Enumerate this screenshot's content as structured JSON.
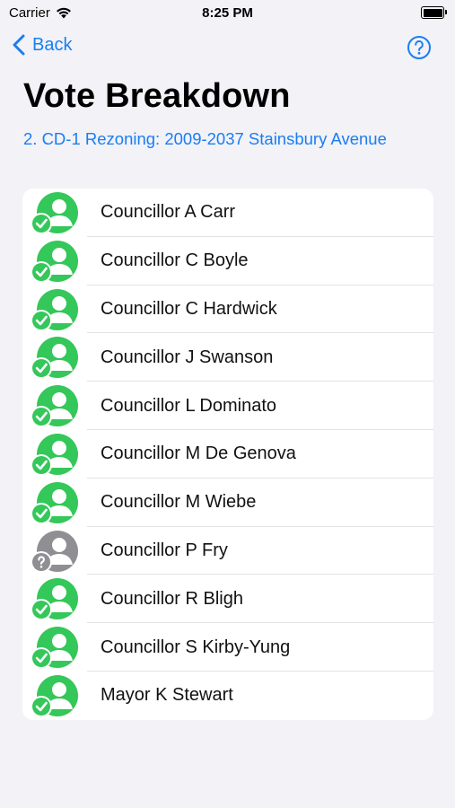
{
  "status_bar": {
    "carrier": "Carrier",
    "time": "8:25 PM"
  },
  "nav": {
    "back_label": "Back",
    "help_icon": "question-circle-icon"
  },
  "page": {
    "title": "Vote Breakdown",
    "subtitle": "2. CD-1 Rezoning: 2009-2037 Stainsbury Avenue"
  },
  "colors": {
    "accent": "#1a7ef2",
    "yes": "#34c759",
    "unknown": "#8e8e93",
    "background": "#f2f2f7"
  },
  "councillors": [
    {
      "name": "Councillor A Carr",
      "vote": "yes"
    },
    {
      "name": "Councillor C Boyle",
      "vote": "yes"
    },
    {
      "name": "Councillor C Hardwick",
      "vote": "yes"
    },
    {
      "name": "Councillor J Swanson",
      "vote": "yes"
    },
    {
      "name": "Councillor L Dominato",
      "vote": "yes"
    },
    {
      "name": "Councillor M De Genova",
      "vote": "yes"
    },
    {
      "name": "Councillor M Wiebe",
      "vote": "yes"
    },
    {
      "name": "Councillor P Fry",
      "vote": "unknown"
    },
    {
      "name": "Councillor R Bligh",
      "vote": "yes"
    },
    {
      "name": "Councillor S Kirby-Yung",
      "vote": "yes"
    },
    {
      "name": "Mayor K Stewart",
      "vote": "yes"
    }
  ]
}
